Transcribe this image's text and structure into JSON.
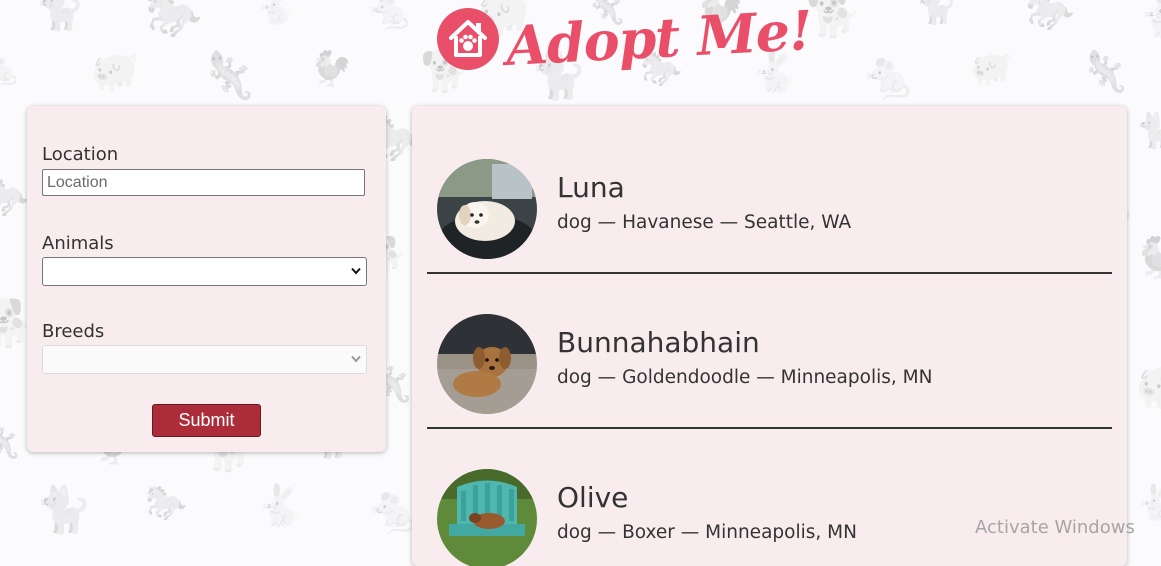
{
  "header": {
    "logo_icon": "house-paw-icon",
    "title": "Adopt Me!"
  },
  "colors": {
    "brand": "#ea4f6a",
    "submit": "#ad2c3a",
    "panel": "#f9ecee"
  },
  "search": {
    "location_label": "Location",
    "location_placeholder": "Location",
    "location_value": "",
    "animals_label": "Animals",
    "animals_value": "",
    "breeds_label": "Breeds",
    "breeds_value": "",
    "breeds_disabled": true,
    "submit_label": "Submit"
  },
  "pets": [
    {
      "name": "Luna",
      "info": "dog — Havanese — Seattle, WA"
    },
    {
      "name": "Bunnahabhain",
      "info": "dog — Goldendoodle — Minneapolis, MN"
    },
    {
      "name": "Olive",
      "info": "dog — Boxer — Minneapolis, MN"
    }
  ],
  "system": {
    "watermark": "Activate Windows"
  }
}
